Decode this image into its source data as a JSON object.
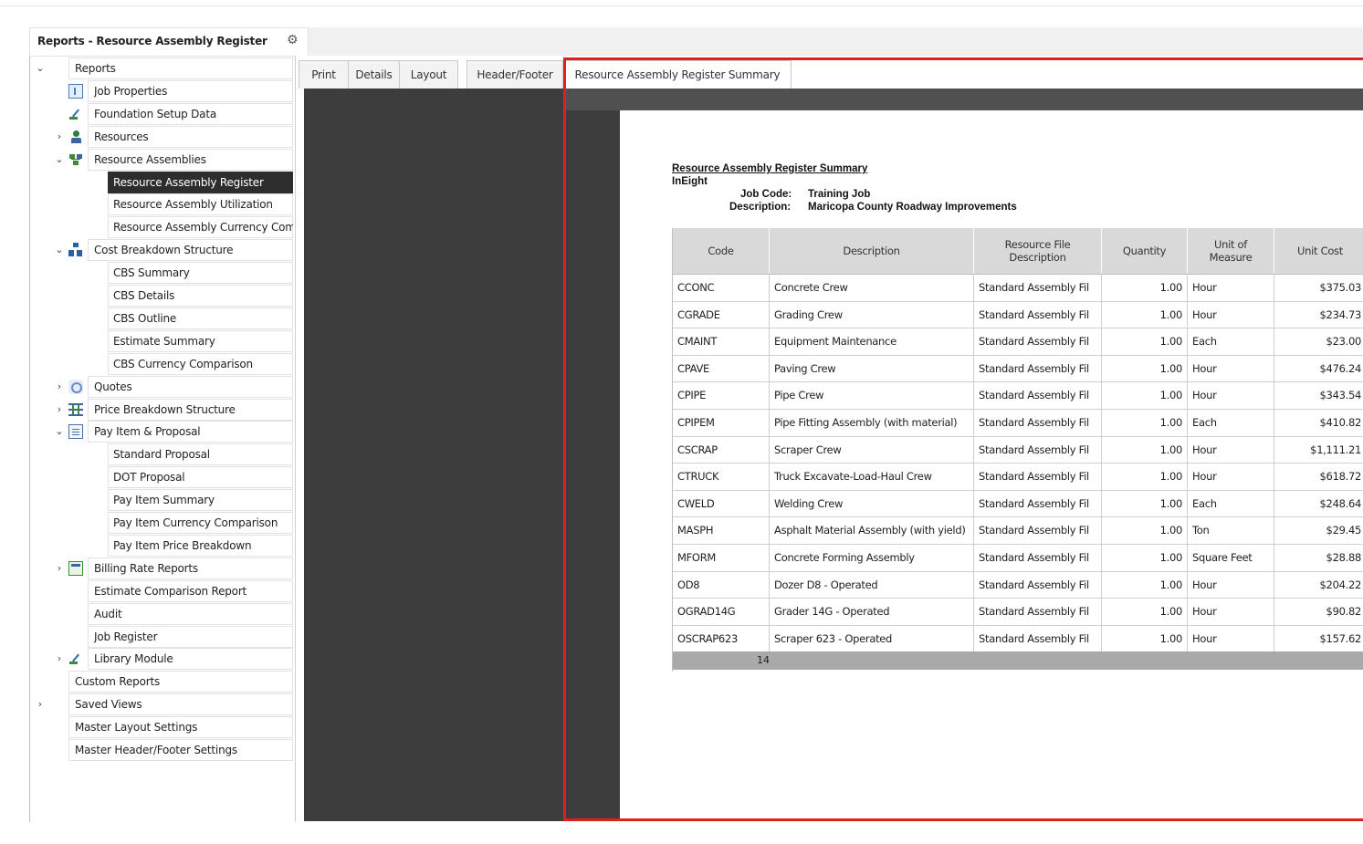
{
  "header": {
    "title": "Reports - Resource Assembly Register"
  },
  "tree": [
    {
      "label": "Reports",
      "expander": "⌄",
      "level": 0,
      "icon": ""
    },
    {
      "label": "Job Properties",
      "expander": "",
      "level": 1,
      "icon": "jobprops"
    },
    {
      "label": "Foundation Setup Data",
      "expander": "",
      "level": 1,
      "icon": "found"
    },
    {
      "label": "Resources",
      "expander": "›",
      "level": 1,
      "icon": "res"
    },
    {
      "label": "Resource Assemblies",
      "expander": "⌄",
      "level": 1,
      "icon": "ra"
    },
    {
      "label": "Resource Assembly Register",
      "expander": "",
      "level": 2,
      "icon": "",
      "selected": true
    },
    {
      "label": "Resource Assembly Utilization",
      "expander": "",
      "level": 2,
      "icon": ""
    },
    {
      "label": "Resource Assembly Currency Comparison",
      "expander": "",
      "level": 2,
      "icon": ""
    },
    {
      "label": "Cost Breakdown Structure",
      "expander": "⌄",
      "level": 1,
      "icon": "cbs"
    },
    {
      "label": "CBS Summary",
      "expander": "",
      "level": 2,
      "icon": ""
    },
    {
      "label": "CBS Details",
      "expander": "",
      "level": 2,
      "icon": ""
    },
    {
      "label": "CBS Outline",
      "expander": "",
      "level": 2,
      "icon": ""
    },
    {
      "label": "Estimate Summary",
      "expander": "",
      "level": 2,
      "icon": ""
    },
    {
      "label": "CBS Currency Comparison",
      "expander": "",
      "level": 2,
      "icon": ""
    },
    {
      "label": "Quotes",
      "expander": "›",
      "level": 1,
      "icon": "quotes"
    },
    {
      "label": "Price Breakdown Structure",
      "expander": "›",
      "level": 1,
      "icon": "pbs"
    },
    {
      "label": "Pay Item & Proposal",
      "expander": "⌄",
      "level": 1,
      "icon": "pay"
    },
    {
      "label": "Standard Proposal",
      "expander": "",
      "level": 2,
      "icon": ""
    },
    {
      "label": "DOT Proposal",
      "expander": "",
      "level": 2,
      "icon": ""
    },
    {
      "label": "Pay Item Summary",
      "expander": "",
      "level": 2,
      "icon": ""
    },
    {
      "label": "Pay Item Currency Comparison",
      "expander": "",
      "level": 2,
      "icon": ""
    },
    {
      "label": "Pay Item Price Breakdown",
      "expander": "",
      "level": 2,
      "icon": ""
    },
    {
      "label": "Billing Rate Reports",
      "expander": "›",
      "level": 1,
      "icon": "billing"
    },
    {
      "label": "Estimate Comparison Report",
      "expander": "",
      "level": 1,
      "icon": ""
    },
    {
      "label": "Audit",
      "expander": "",
      "level": 1,
      "icon": ""
    },
    {
      "label": "Job Register",
      "expander": "",
      "level": 1,
      "icon": ""
    },
    {
      "label": "Library Module",
      "expander": "›",
      "level": 1,
      "icon": "lib"
    },
    {
      "label": "Custom Reports",
      "expander": "",
      "level": 0,
      "icon": ""
    },
    {
      "label": "Saved Views",
      "expander": "›",
      "level": 0,
      "icon": ""
    },
    {
      "label": "Master Layout Settings",
      "expander": "",
      "level": 0,
      "icon": ""
    },
    {
      "label": "Master Header/Footer Settings",
      "expander": "",
      "level": 0,
      "icon": ""
    }
  ],
  "tabs": [
    {
      "label": "Print",
      "active": false
    },
    {
      "label": "Details",
      "active": false
    },
    {
      "label": "Layout",
      "active": false
    },
    {
      "label": "Header/Footer",
      "active": false
    },
    {
      "label": "Resource Assembly Register Summary",
      "active": true
    }
  ],
  "report": {
    "title": "Resource Assembly Register Summary",
    "company": "InEight",
    "job_code_label": "Job Code:",
    "job_code": "Training Job",
    "description_label": "Description:",
    "description": "Maricopa County Roadway Improvements",
    "columns": [
      "Code",
      "Description",
      "Resource File Description",
      "Quantity",
      "Unit of Measure",
      "Unit Cost"
    ],
    "rows": [
      [
        "CCONC",
        "Concrete Crew",
        "Standard Assembly Fil",
        "1.00",
        "Hour",
        "$375.03"
      ],
      [
        "CGRADE",
        "Grading Crew",
        "Standard Assembly Fil",
        "1.00",
        "Hour",
        "$234.73"
      ],
      [
        "CMAINT",
        "Equipment Maintenance",
        "Standard Assembly Fil",
        "1.00",
        "Each",
        "$23.00"
      ],
      [
        "CPAVE",
        "Paving Crew",
        "Standard Assembly Fil",
        "1.00",
        "Hour",
        "$476.24"
      ],
      [
        "CPIPE",
        "Pipe Crew",
        "Standard Assembly Fil",
        "1.00",
        "Hour",
        "$343.54"
      ],
      [
        "CPIPEM",
        "Pipe Fitting Assembly (with material)",
        "Standard Assembly Fil",
        "1.00",
        "Each",
        "$410.82"
      ],
      [
        "CSCRAP",
        "Scraper Crew",
        "Standard Assembly Fil",
        "1.00",
        "Hour",
        "$1,111.21"
      ],
      [
        "CTRUCK",
        "Truck Excavate-Load-Haul Crew",
        "Standard Assembly Fil",
        "1.00",
        "Hour",
        "$618.72"
      ],
      [
        "CWELD",
        "Welding Crew",
        "Standard Assembly Fil",
        "1.00",
        "Each",
        "$248.64"
      ],
      [
        "MASPH",
        "Asphalt Material Assembly (with yield)",
        "Standard Assembly Fil",
        "1.00",
        "Ton",
        "$29.45"
      ],
      [
        "MFORM",
        "Concrete Forming Assembly",
        "Standard Assembly Fil",
        "1.00",
        "Square Feet",
        "$28.88"
      ],
      [
        "OD8",
        "Dozer D8 - Operated",
        "Standard Assembly Fil",
        "1.00",
        "Hour",
        "$204.22"
      ],
      [
        "OGRAD14G",
        "Grader 14G - Operated",
        "Standard Assembly Fil",
        "1.00",
        "Hour",
        "$90.82"
      ],
      [
        "OSCRAP623",
        "Scraper 623 - Operated",
        "Standard Assembly Fil",
        "1.00",
        "Hour",
        "$157.62"
      ]
    ],
    "row_count": "14"
  }
}
